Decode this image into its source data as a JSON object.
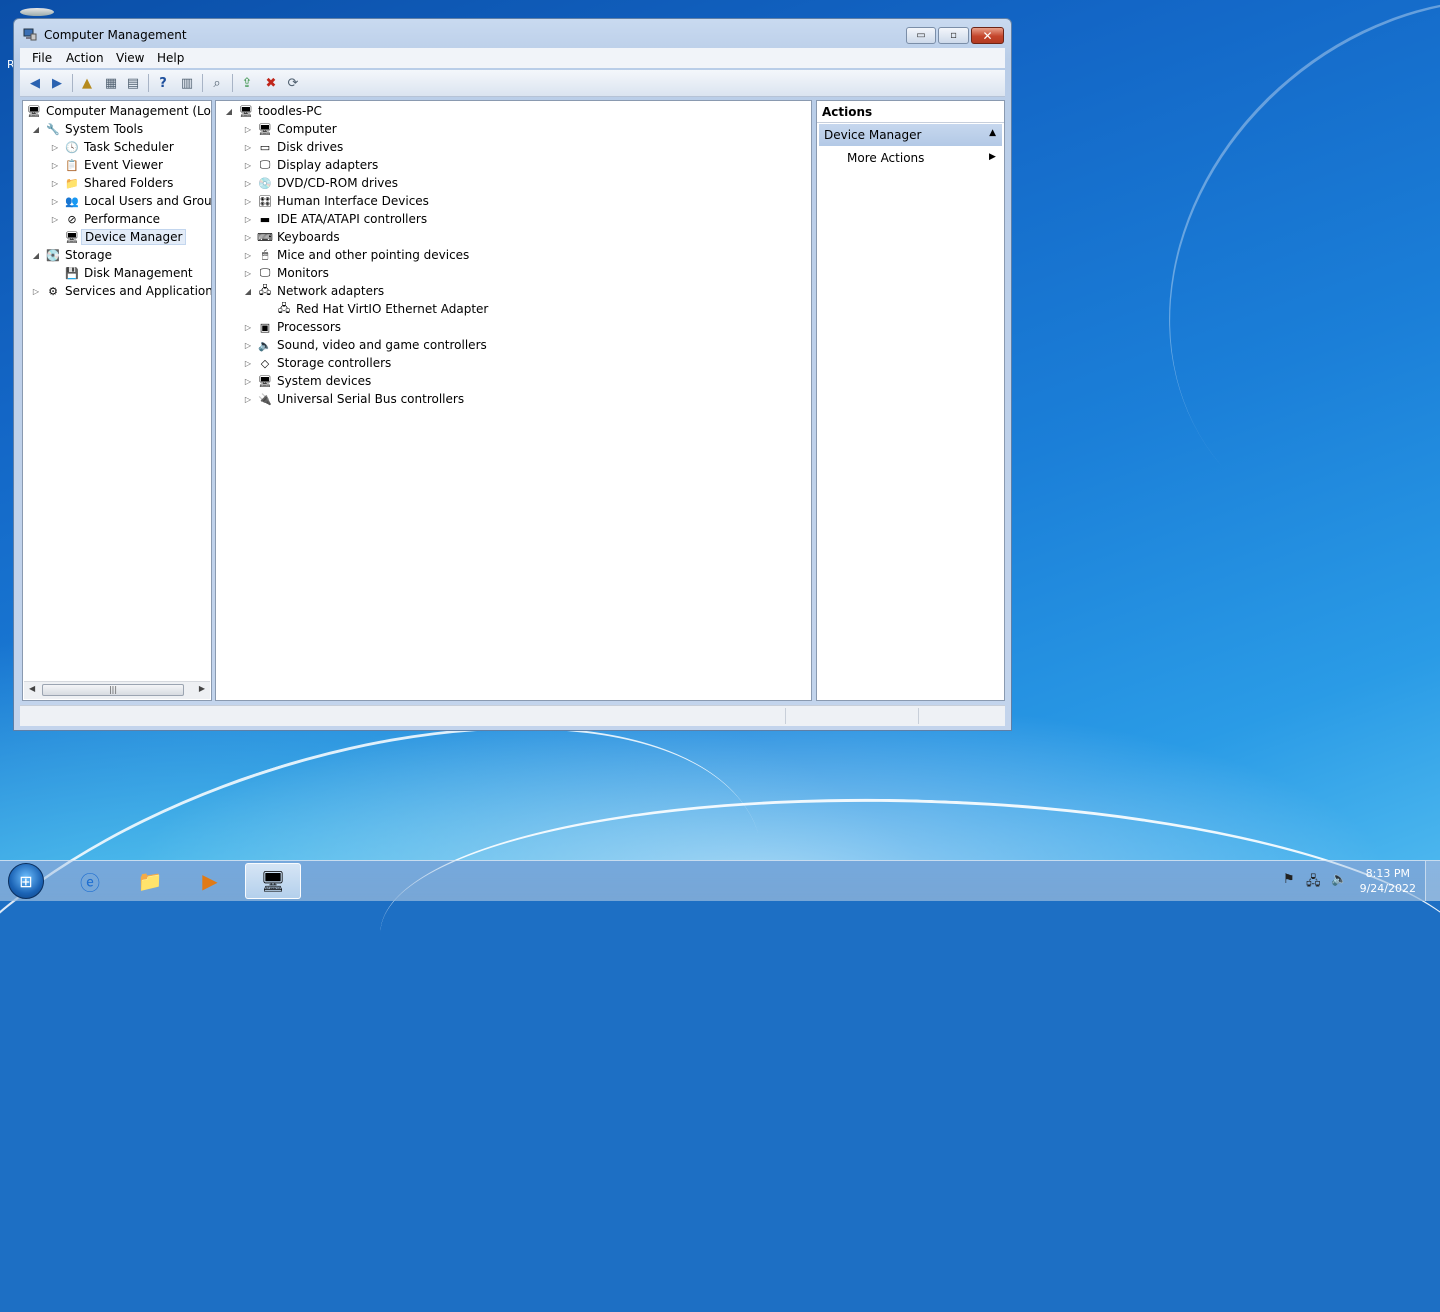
{
  "window": {
    "title": "Computer Management",
    "minimize": "▭",
    "maximize": "▫",
    "close": "✕"
  },
  "menu": [
    "File",
    "Action",
    "View",
    "Help"
  ],
  "left_tree": {
    "root": "Computer Management (Local",
    "items": [
      {
        "label": "System Tools",
        "level": 1,
        "twisty": "◢",
        "icon": "🔧"
      },
      {
        "label": "Task Scheduler",
        "level": 2,
        "twisty": "▷",
        "icon": "🕓"
      },
      {
        "label": "Event Viewer",
        "level": 2,
        "twisty": "▷",
        "icon": "📋"
      },
      {
        "label": "Shared Folders",
        "level": 2,
        "twisty": "▷",
        "icon": "📁"
      },
      {
        "label": "Local Users and Groups",
        "level": 2,
        "twisty": "▷",
        "icon": "👥"
      },
      {
        "label": "Performance",
        "level": 2,
        "twisty": "▷",
        "icon": "⊘"
      },
      {
        "label": "Device Manager",
        "level": 2,
        "twisty": "",
        "icon": "🖥"
      },
      {
        "label": "Storage",
        "level": 1,
        "twisty": "◢",
        "icon": "💽"
      },
      {
        "label": "Disk Management",
        "level": 2,
        "twisty": "",
        "icon": "💾"
      },
      {
        "label": "Services and Applications",
        "level": 1,
        "twisty": "▷",
        "icon": "⚙"
      }
    ]
  },
  "device_tree": {
    "root": "toodles-PC",
    "items": [
      {
        "label": "Computer",
        "level": 1,
        "twisty": "▷",
        "icon": "🖥"
      },
      {
        "label": "Disk drives",
        "level": 1,
        "twisty": "▷",
        "icon": "▭"
      },
      {
        "label": "Display adapters",
        "level": 1,
        "twisty": "▷",
        "icon": "🖵"
      },
      {
        "label": "DVD/CD-ROM drives",
        "level": 1,
        "twisty": "▷",
        "icon": "💿"
      },
      {
        "label": "Human Interface Devices",
        "level": 1,
        "twisty": "▷",
        "icon": "🎛"
      },
      {
        "label": "IDE ATA/ATAPI controllers",
        "level": 1,
        "twisty": "▷",
        "icon": "▬"
      },
      {
        "label": "Keyboards",
        "level": 1,
        "twisty": "▷",
        "icon": "⌨"
      },
      {
        "label": "Mice and other pointing devices",
        "level": 1,
        "twisty": "▷",
        "icon": "🖱"
      },
      {
        "label": "Monitors",
        "level": 1,
        "twisty": "▷",
        "icon": "🖵"
      },
      {
        "label": "Network adapters",
        "level": 1,
        "twisty": "◢",
        "icon": "🖧"
      },
      {
        "label": "Red Hat VirtIO Ethernet Adapter",
        "level": 2,
        "twisty": "",
        "icon": "🖧"
      },
      {
        "label": "Processors",
        "level": 1,
        "twisty": "▷",
        "icon": "▣"
      },
      {
        "label": "Sound, video and game controllers",
        "level": 1,
        "twisty": "▷",
        "icon": "🔈"
      },
      {
        "label": "Storage controllers",
        "level": 1,
        "twisty": "▷",
        "icon": "◇"
      },
      {
        "label": "System devices",
        "level": 1,
        "twisty": "▷",
        "icon": "🖥"
      },
      {
        "label": "Universal Serial Bus controllers",
        "level": 1,
        "twisty": "▷",
        "icon": "🔌"
      }
    ]
  },
  "actions": {
    "header": "Actions",
    "section": "Device Manager",
    "item": "More Actions"
  },
  "taskbar": {
    "clock_time": "8:13 PM",
    "clock_date": "9/24/2022"
  }
}
